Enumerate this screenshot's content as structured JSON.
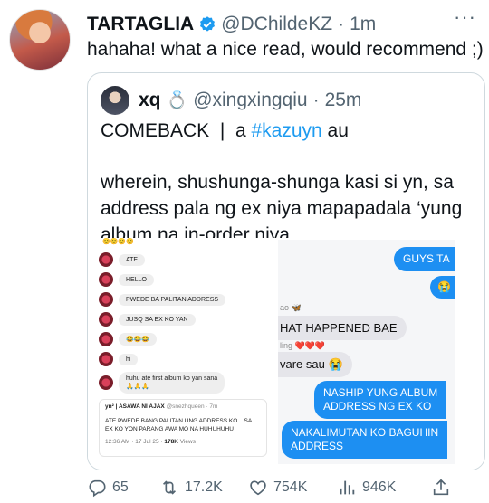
{
  "tweet": {
    "display_name": "TARTAGLIA",
    "handle": "@DChildeKZ",
    "separator": "·",
    "time": "1m",
    "more": "···",
    "text": "hahaha! what a nice read, would recommend ;)",
    "verified_color": "#1d9bf0"
  },
  "quote": {
    "display_name": "xq",
    "ring": "💍",
    "handle": "@xingxingqiu",
    "separator": "·",
    "time": "25m",
    "line1_prefix": "COMEBACK  |  a ",
    "hashtag": "#kazuyn",
    "line1_suffix": " au",
    "paragraph": "wherein, shushunga-shunga kasi si yn, sa address pala ng ex niya mapapadala ‘yung album na in-order niya."
  },
  "left_screenshot": {
    "top_emojis": "😊😊😊😊",
    "messages": [
      "ATE",
      "HELLO",
      "PWEDE BA PALITAN ADDRESS",
      "JUSQ SA EX KO YAN",
      "😂😂😂",
      "hi",
      "huhu ate first album ko yan sana\n🙏🙏🙏"
    ],
    "card": {
      "name": "yn² | ASAWA NI AJAX",
      "handle": "@snezhqueen · 7m",
      "text": "ATE PWEDE BANG PALITAN UNG ADDRESS KO... SA EX KO YON PARANG AWA MO NA HUHUHUHU",
      "meta_prefix": "12:36 AM · 17 Jul 25 · ",
      "views_count": "178K",
      "views_label": " Views"
    }
  },
  "right_screenshot": {
    "blue_1": "GUYS TA",
    "blue_2": "😭",
    "sender_1": "ao 🦋",
    "grey_1": "HAT HAPPENED BAE",
    "sender_2": "ling ❤️❤️❤️",
    "grey_2": "vare sau 😭",
    "blue_3": "NASHIP YUNG ALBUM\nADDRESS NG EX KO",
    "blue_4": "NAKALIMUTAN KO BAGUHIN\nADDRESS"
  },
  "actions": {
    "replies": "65",
    "retweets": "17.2K",
    "likes": "754K",
    "views": "946K"
  }
}
